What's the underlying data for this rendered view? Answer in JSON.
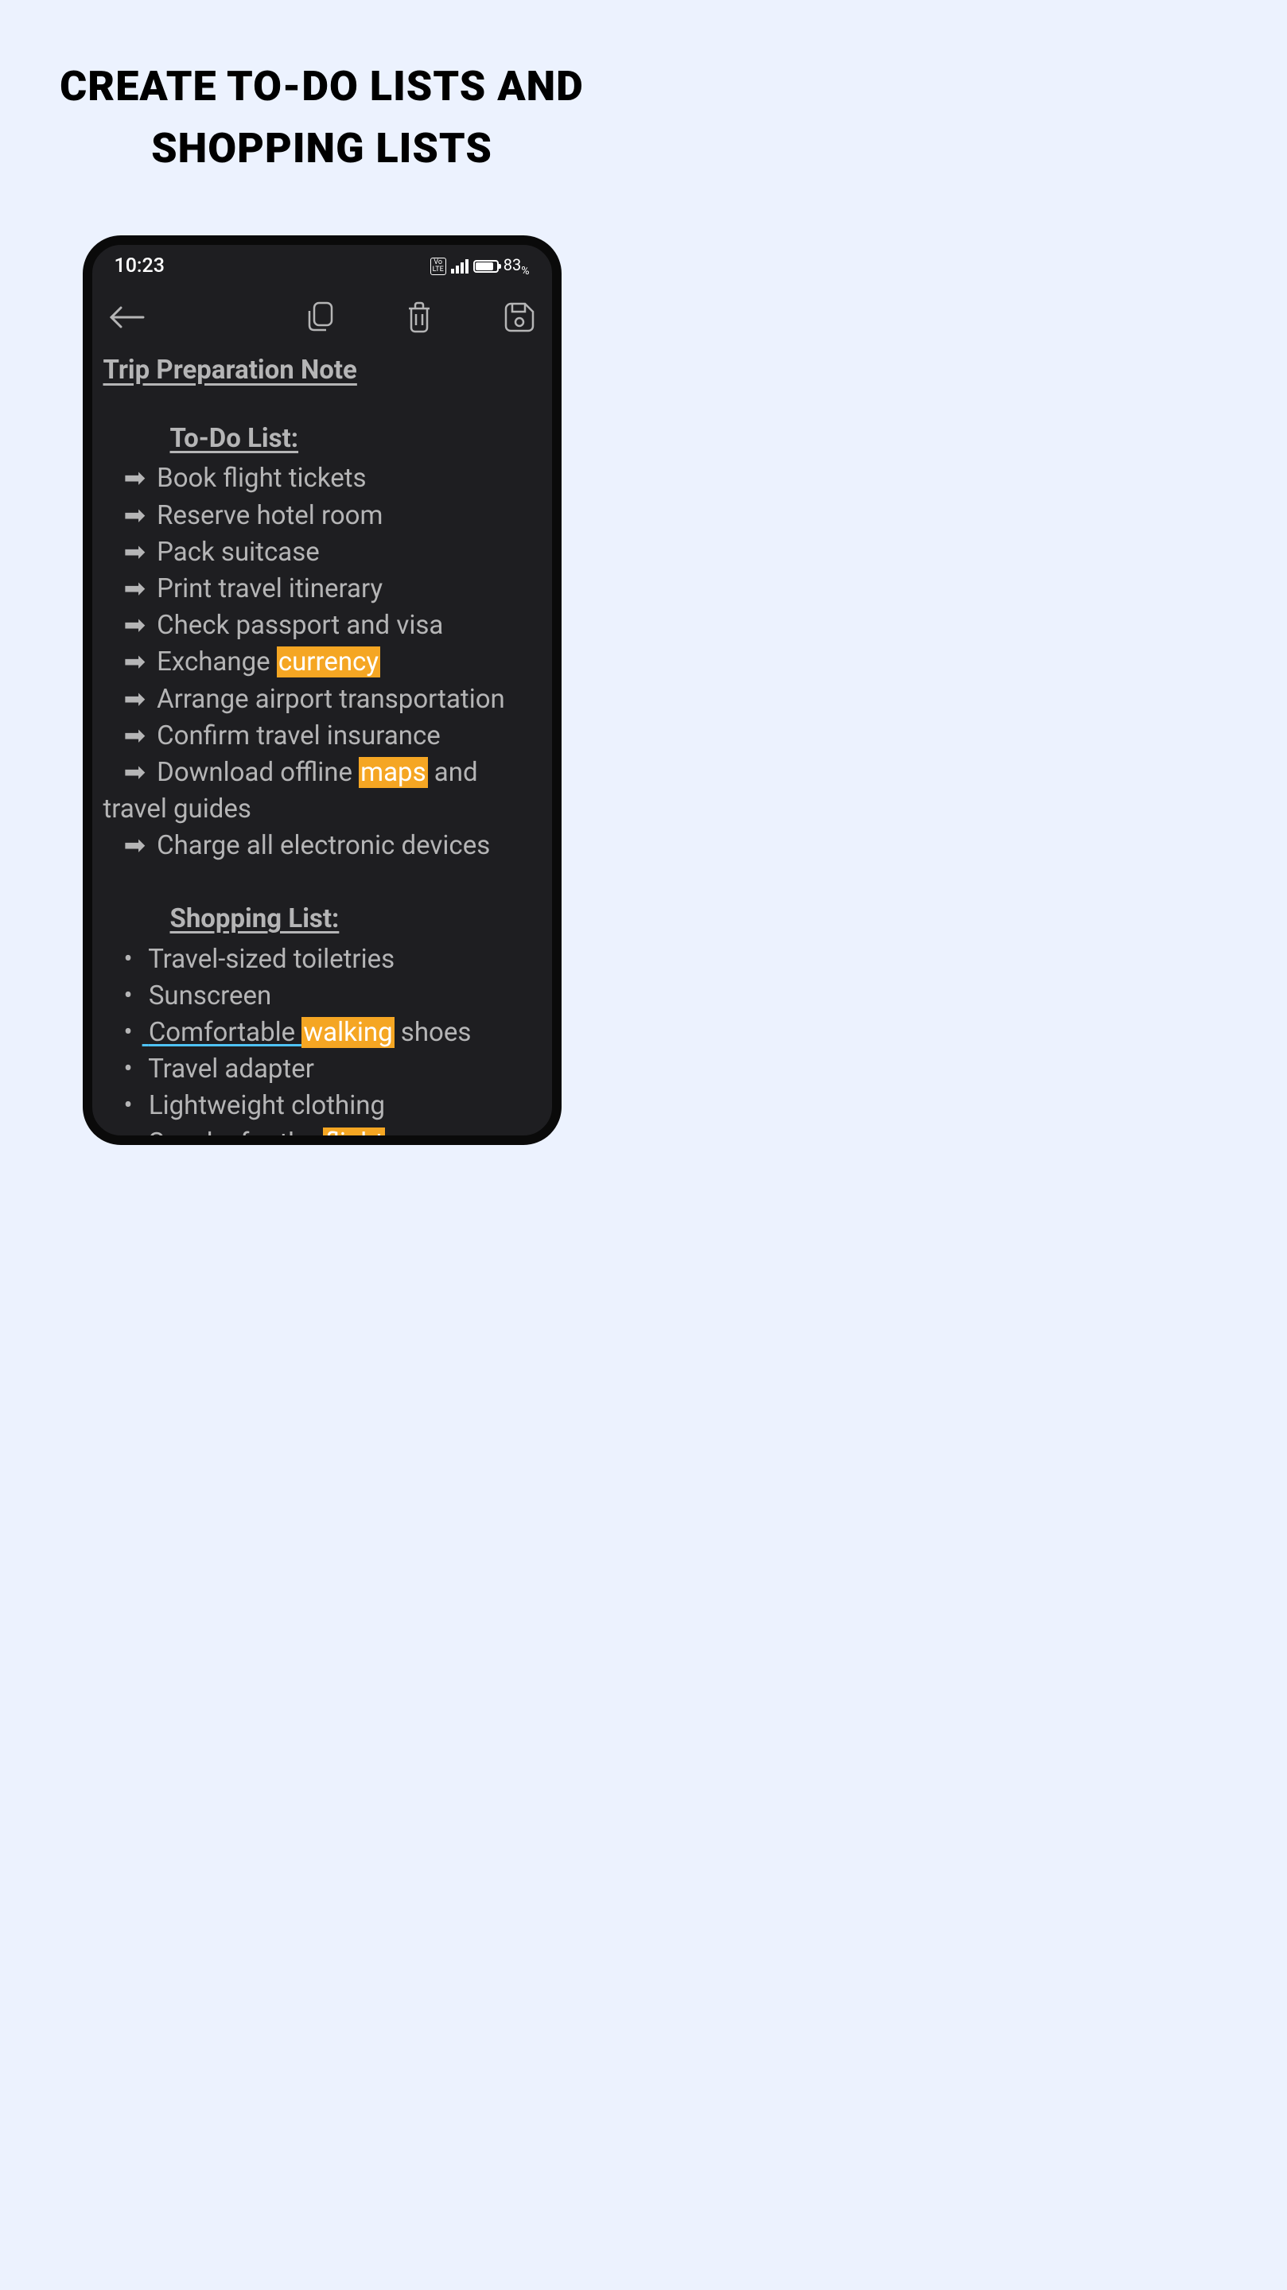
{
  "promo": {
    "title": "CREATE TO-DO LISTS AND SHOPPING LISTS"
  },
  "statusBar": {
    "time": "10:23",
    "battery": "83"
  },
  "note": {
    "title": "Trip Preparation Note",
    "todoSection": {
      "heading": "To-Do List:",
      "items": [
        {
          "text": "Book flight tickets"
        },
        {
          "text": "Reserve hotel room"
        },
        {
          "text": "Pack suitcase"
        },
        {
          "text": "Print travel itinerary"
        },
        {
          "text": "Check passport and visa"
        },
        {
          "prefix": "Exchange ",
          "highlight": "currency"
        },
        {
          "text": "Arrange airport transportation"
        },
        {
          "text": "Confirm travel insurance"
        },
        {
          "prefix": "Download offline ",
          "highlight": "maps",
          "suffix": " and"
        },
        {
          "continuation": "travel guides"
        },
        {
          "text": "Charge all electronic devices"
        }
      ]
    },
    "shoppingSection": {
      "heading": "Shopping List:",
      "items": [
        {
          "text": "Travel-sized toiletries"
        },
        {
          "text": "Sunscreen"
        },
        {
          "linkPrefix": "Comfortable ",
          "highlight": "walking",
          "suffix": " shoes"
        },
        {
          "text": "Travel adapter"
        },
        {
          "text": "Lightweight clothing"
        },
        {
          "prefix": "Snacks for the ",
          "highlight": "flight"
        }
      ]
    }
  }
}
